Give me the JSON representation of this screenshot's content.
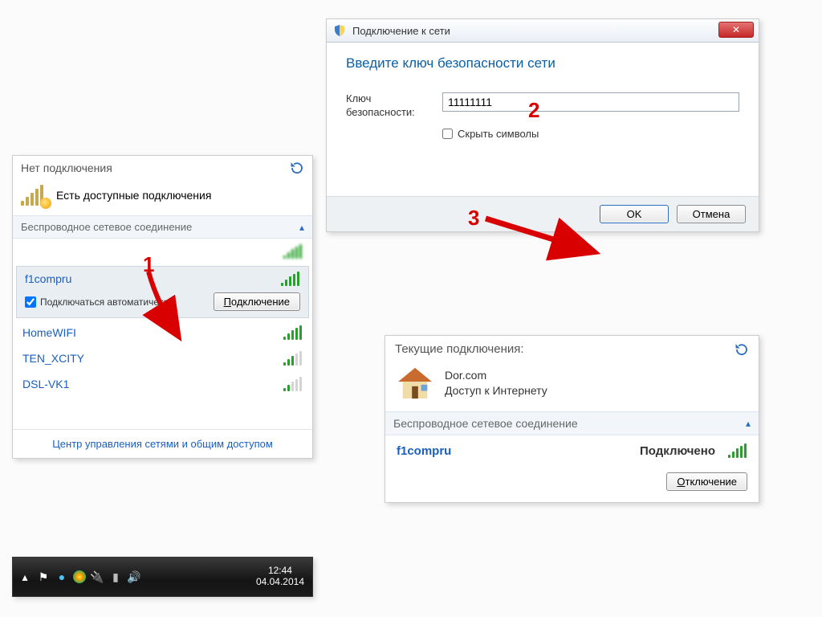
{
  "annotations": {
    "step1": "1",
    "step2": "2",
    "step3": "3"
  },
  "flyout": {
    "title": "Нет подключения",
    "available_label": "Есть доступные подключения",
    "section": "Беспроводное сетевое соединение",
    "networks": {
      "blurred": "",
      "selected": "f1compru",
      "auto_label": "Подключаться автоматически",
      "connect_btn": "Подключение",
      "n1": "HomeWIFI",
      "n2": "TEN_XCITY",
      "n3": "DSL-VK1"
    },
    "center_link": "Центр управления сетями и общим доступом"
  },
  "taskbar": {
    "time": "12:44",
    "date": "04.04.2014"
  },
  "dialog": {
    "title": "Подключение к сети",
    "instruction": "Введите ключ безопасности сети",
    "key_label": "Ключ безопасности:",
    "key_value": "11111111",
    "hide_label": "Скрыть символы",
    "ok": "OK",
    "cancel": "Отмена"
  },
  "current": {
    "header": "Текущие подключения:",
    "account_name": "Dor.com",
    "account_status": "Доступ к Интернету",
    "section": "Беспроводное сетевое соединение",
    "net": "f1compru",
    "status": "Подключено",
    "disconnect": "Отключение"
  }
}
